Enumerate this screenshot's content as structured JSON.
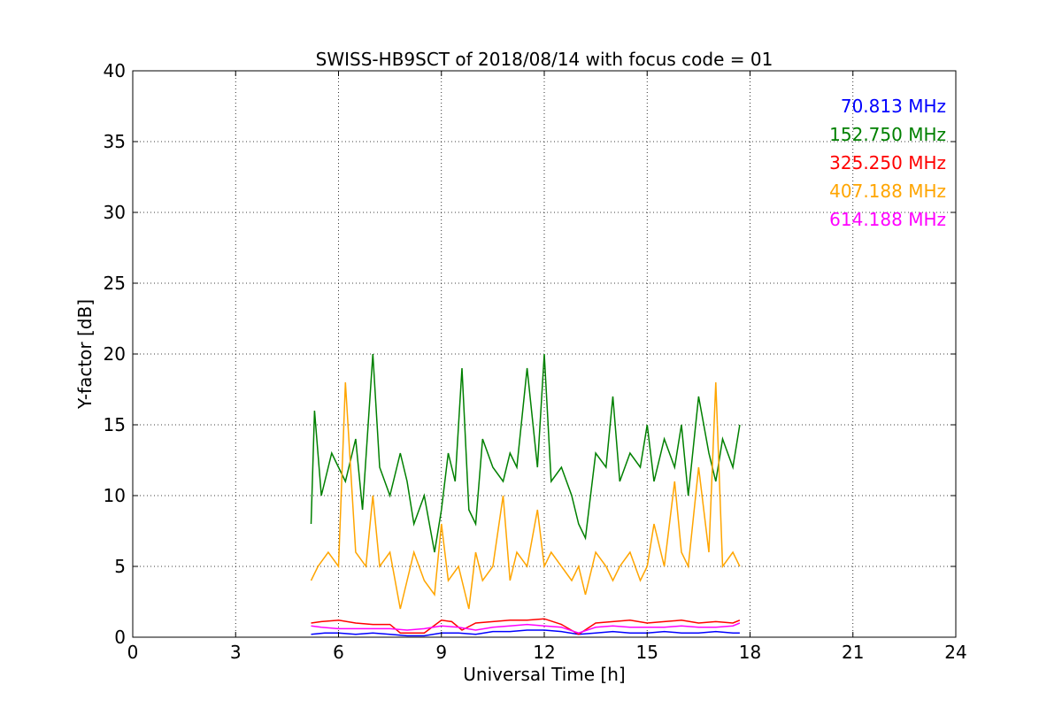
{
  "chart_data": {
    "type": "line",
    "title": "SWISS-HB9SCT of 2018/08/14 with focus code = 01",
    "xlabel": "Universal Time [h]",
    "ylabel": "Y-factor [dB]",
    "xlim": [
      0,
      24
    ],
    "ylim": [
      0,
      40
    ],
    "xticks": [
      0,
      3,
      6,
      9,
      12,
      15,
      18,
      21,
      24
    ],
    "yticks": [
      0,
      5,
      10,
      15,
      20,
      25,
      30,
      35,
      40
    ],
    "grid": true,
    "legend_position": "top-right",
    "series": [
      {
        "name": "70.813 MHz",
        "color": "#0000ff",
        "x": [
          5.2,
          5.6,
          6.0,
          6.5,
          7.0,
          7.5,
          8.0,
          8.5,
          9.0,
          9.5,
          10.0,
          10.5,
          11.0,
          11.5,
          12.0,
          12.5,
          13.0,
          13.5,
          14.0,
          14.5,
          15.0,
          15.5,
          16.0,
          16.5,
          17.0,
          17.5,
          17.7
        ],
        "values": [
          0.2,
          0.3,
          0.3,
          0.2,
          0.3,
          0.2,
          0.1,
          0.1,
          0.3,
          0.3,
          0.2,
          0.4,
          0.4,
          0.5,
          0.5,
          0.4,
          0.2,
          0.3,
          0.4,
          0.3,
          0.3,
          0.4,
          0.3,
          0.3,
          0.4,
          0.3,
          0.3
        ]
      },
      {
        "name": "152.750 MHz",
        "color": "#008000",
        "x": [
          5.2,
          5.3,
          5.5,
          5.8,
          6.0,
          6.2,
          6.5,
          6.7,
          7.0,
          7.2,
          7.5,
          7.8,
          8.0,
          8.2,
          8.5,
          8.8,
          9.0,
          9.2,
          9.4,
          9.6,
          9.8,
          10.0,
          10.2,
          10.5,
          10.8,
          11.0,
          11.2,
          11.5,
          11.8,
          12.0,
          12.2,
          12.5,
          12.8,
          13.0,
          13.2,
          13.5,
          13.8,
          14.0,
          14.2,
          14.5,
          14.8,
          15.0,
          15.2,
          15.5,
          15.8,
          16.0,
          16.2,
          16.5,
          16.8,
          17.0,
          17.2,
          17.5,
          17.7
        ],
        "values": [
          8,
          16,
          10,
          13,
          12,
          11,
          14,
          9,
          20,
          12,
          10,
          13,
          11,
          8,
          10,
          6,
          9,
          13,
          11,
          19,
          9,
          8,
          14,
          12,
          11,
          13,
          12,
          19,
          12,
          20,
          11,
          12,
          10,
          8,
          7,
          13,
          12,
          17,
          11,
          13,
          12,
          15,
          11,
          14,
          12,
          15,
          10,
          17,
          13,
          11,
          14,
          12,
          15
        ]
      },
      {
        "name": "325.250 MHz",
        "color": "#ff0000",
        "x": [
          5.2,
          5.5,
          6.0,
          6.5,
          7.0,
          7.5,
          7.8,
          8.0,
          8.5,
          9.0,
          9.3,
          9.6,
          10.0,
          10.5,
          11.0,
          11.5,
          12.0,
          12.5,
          13.0,
          13.5,
          14.0,
          14.5,
          15.0,
          15.5,
          16.0,
          16.5,
          17.0,
          17.5,
          17.7
        ],
        "values": [
          1.0,
          1.1,
          1.2,
          1.0,
          0.9,
          0.9,
          0.3,
          0.3,
          0.3,
          1.2,
          1.1,
          0.5,
          1.0,
          1.1,
          1.2,
          1.2,
          1.3,
          0.9,
          0.2,
          1.0,
          1.1,
          1.2,
          1.0,
          1.1,
          1.2,
          1.0,
          1.1,
          1.0,
          1.2
        ]
      },
      {
        "name": "407.188 MHz",
        "color": "#ffa500",
        "x": [
          5.2,
          5.4,
          5.7,
          6.0,
          6.2,
          6.5,
          6.8,
          7.0,
          7.2,
          7.5,
          7.8,
          8.0,
          8.2,
          8.5,
          8.8,
          9.0,
          9.2,
          9.5,
          9.8,
          10.0,
          10.2,
          10.5,
          10.8,
          11.0,
          11.2,
          11.5,
          11.8,
          12.0,
          12.2,
          12.5,
          12.8,
          13.0,
          13.2,
          13.5,
          13.8,
          14.0,
          14.2,
          14.5,
          14.8,
          15.0,
          15.2,
          15.5,
          15.8,
          16.0,
          16.2,
          16.5,
          16.8,
          17.0,
          17.2,
          17.5,
          17.7
        ],
        "values": [
          4,
          5,
          6,
          5,
          18,
          6,
          5,
          10,
          5,
          6,
          2,
          4,
          6,
          4,
          3,
          8,
          4,
          5,
          2,
          6,
          4,
          5,
          10,
          4,
          6,
          5,
          9,
          5,
          6,
          5,
          4,
          5,
          3,
          6,
          5,
          4,
          5,
          6,
          4,
          5,
          8,
          5,
          11,
          6,
          5,
          12,
          6,
          18,
          5,
          6,
          5
        ]
      },
      {
        "name": "614.188 MHz",
        "color": "#ff00ff",
        "x": [
          5.2,
          5.5,
          6.0,
          6.5,
          7.0,
          7.5,
          8.0,
          8.5,
          9.0,
          9.5,
          10.0,
          10.5,
          11.0,
          11.5,
          12.0,
          12.5,
          13.0,
          13.5,
          14.0,
          14.5,
          15.0,
          15.5,
          16.0,
          16.5,
          17.0,
          17.5,
          17.7
        ],
        "values": [
          0.8,
          0.7,
          0.6,
          0.6,
          0.6,
          0.6,
          0.5,
          0.6,
          0.8,
          0.7,
          0.5,
          0.7,
          0.8,
          0.9,
          0.8,
          0.7,
          0.3,
          0.7,
          0.8,
          0.7,
          0.7,
          0.7,
          0.8,
          0.7,
          0.7,
          0.8,
          1.0
        ]
      }
    ]
  }
}
